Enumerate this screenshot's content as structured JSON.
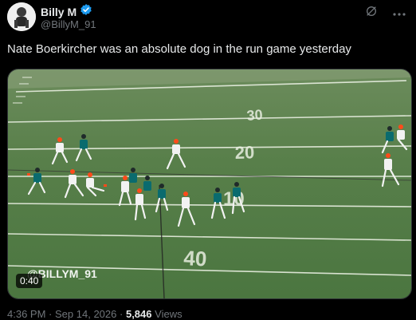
{
  "author": {
    "display_name": "Billy M",
    "handle": "@BillyM_91",
    "verified": true
  },
  "icons": {
    "verified": "verified-badge-icon",
    "grok": "grok-icon",
    "more": "more-icon"
  },
  "tweet": {
    "text": "Nate Boerkircher was an absolute dog in the run game yesterday"
  },
  "media": {
    "watermark": "@BILLYM_91",
    "duration": "0:40"
  },
  "meta": {
    "time": "4:36 PM",
    "separator": "·",
    "date": "Sep 14, 2026",
    "views_count": "5,846",
    "views_label": "Views"
  },
  "colors": {
    "background": "#000000",
    "verified_blue": "#1d9bf0",
    "field_green": "#4f7a44",
    "jersey_teal": "#0a6b6e",
    "jersey_white": "#f2f2f2",
    "helmet_orange": "#ff4a1a",
    "secondary_text": "#71767b"
  }
}
